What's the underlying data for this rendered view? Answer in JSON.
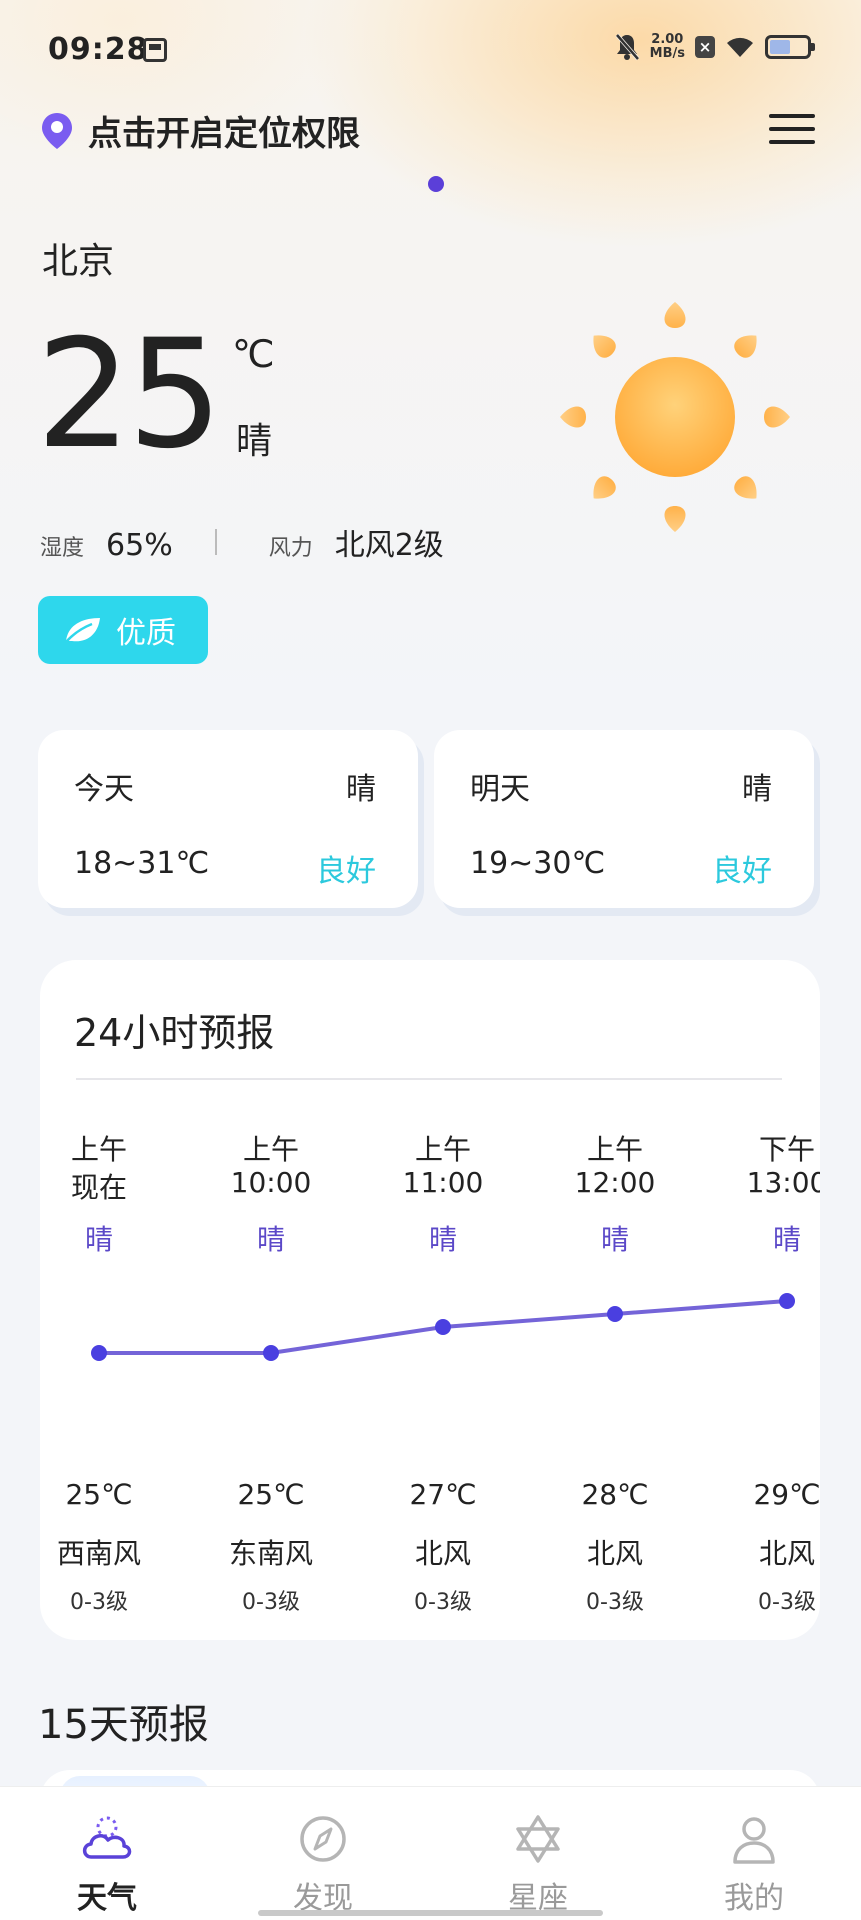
{
  "status_bar": {
    "time": "09:28",
    "net_speed_value": "2.00",
    "net_speed_unit": "MB/s",
    "battery_percent": 55
  },
  "header": {
    "location_prompt": "点击开启定位权限",
    "menu_icon": "hamburger-menu-icon",
    "page_indicator_count": 1
  },
  "current": {
    "city": "北京",
    "temperature": "25",
    "unit": "℃",
    "condition": "晴",
    "humidity_label": "湿度",
    "humidity_value": "65%",
    "wind_label": "风力",
    "wind_value": "北风2级",
    "air_quality": "优质",
    "weather_icon": "sun-icon"
  },
  "days": [
    {
      "name": "今天",
      "condition": "晴",
      "range": "18~31℃",
      "quality": "良好"
    },
    {
      "name": "明天",
      "condition": "晴",
      "range": "19~30℃",
      "quality": "良好"
    }
  ],
  "hourly": {
    "title": "24小时预报",
    "hours": [
      {
        "ampm": "上午",
        "time": "现在",
        "condition": "晴",
        "temp": "25℃",
        "wind": "西南风",
        "level": "0-3级"
      },
      {
        "ampm": "上午",
        "time": "10:00",
        "condition": "晴",
        "temp": "25℃",
        "wind": "东南风",
        "level": "0-3级"
      },
      {
        "ampm": "上午",
        "time": "11:00",
        "condition": "晴",
        "temp": "27℃",
        "wind": "北风",
        "level": "0-3级"
      },
      {
        "ampm": "上午",
        "time": "12:00",
        "condition": "晴",
        "temp": "28℃",
        "wind": "北风",
        "level": "0-3级"
      },
      {
        "ampm": "下午",
        "time": "13:00",
        "condition": "晴",
        "temp": "29℃",
        "wind": "北风",
        "level": "0-3级"
      }
    ],
    "temps_numeric": [
      25,
      25,
      27,
      28,
      29
    ],
    "line_color": "#7464d8",
    "dot_color": "#4a3fe0"
  },
  "forecast15": {
    "title": "15天预报"
  },
  "tabbar": {
    "tabs": [
      {
        "label": "天气",
        "icon": "cloud-weather-icon",
        "active": true
      },
      {
        "label": "发现",
        "icon": "compass-icon",
        "active": false
      },
      {
        "label": "星座",
        "icon": "star-of-david-icon",
        "active": false
      },
      {
        "label": "我的",
        "icon": "user-profile-icon",
        "active": false
      }
    ]
  }
}
